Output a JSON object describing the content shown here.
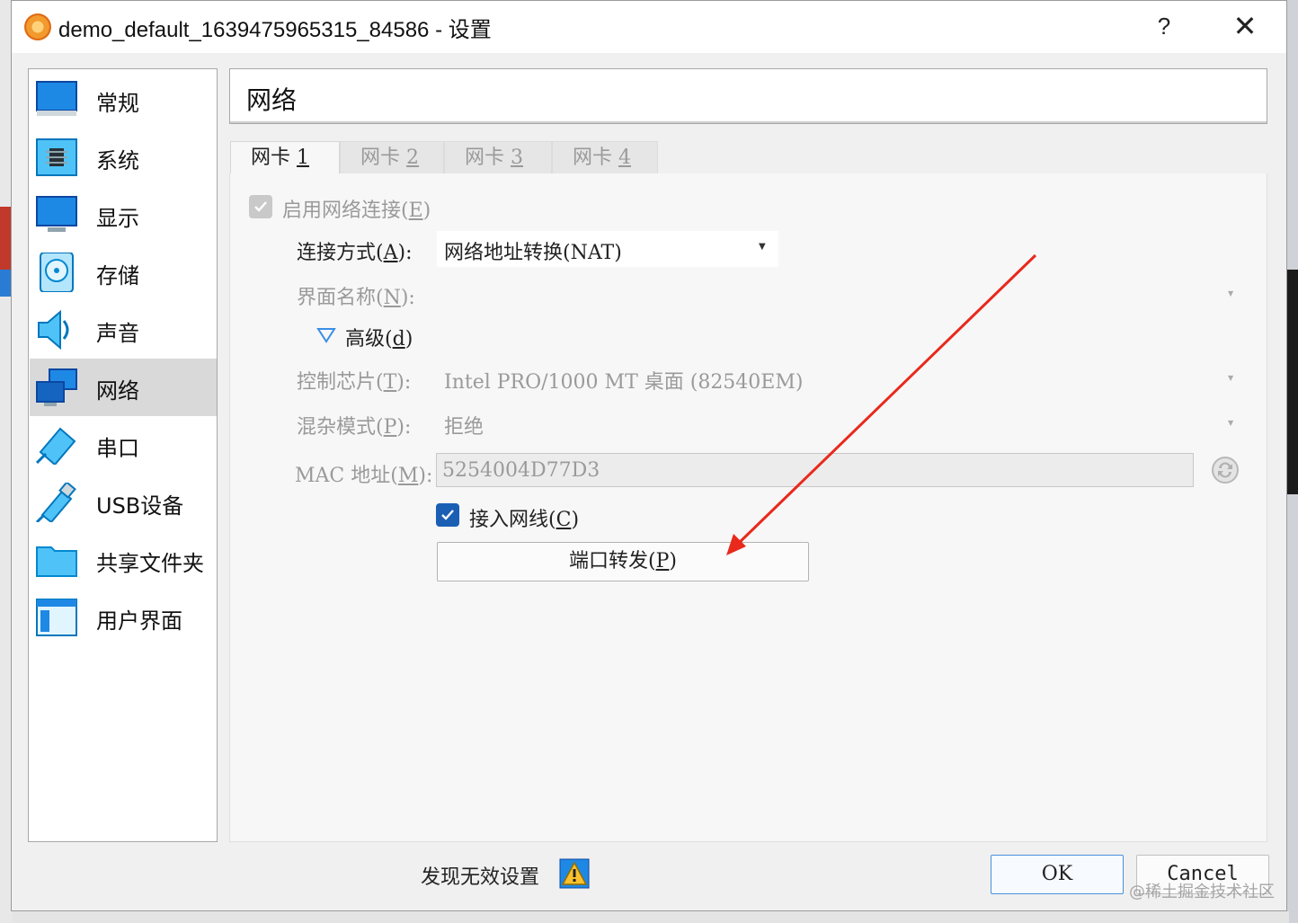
{
  "window": {
    "title": "demo_default_1639475965315_84586 - 设置",
    "help": "?",
    "close": "✕"
  },
  "sidebar": {
    "items": [
      {
        "label": "常规",
        "icon": "monitor-icon"
      },
      {
        "label": "系统",
        "icon": "chip-icon"
      },
      {
        "label": "显示",
        "icon": "display-icon"
      },
      {
        "label": "存储",
        "icon": "disk-icon"
      },
      {
        "label": "声音",
        "icon": "speaker-icon"
      },
      {
        "label": "网络",
        "icon": "network-icon"
      },
      {
        "label": "串口",
        "icon": "serial-port-icon"
      },
      {
        "label": "USB设备",
        "icon": "usb-icon"
      },
      {
        "label": "共享文件夹",
        "icon": "folder-icon"
      },
      {
        "label": "用户界面",
        "icon": "window-icon"
      }
    ],
    "selected": "网络"
  },
  "page": {
    "title": "网络"
  },
  "tabs": [
    {
      "label": "网卡 ",
      "key": "1"
    },
    {
      "label": "网卡 ",
      "key": "2"
    },
    {
      "label": "网卡 ",
      "key": "3"
    },
    {
      "label": "网卡 ",
      "key": "4"
    }
  ],
  "form": {
    "enable": {
      "label": "启用网络连接(",
      "key": "E",
      "close": ")",
      "checked": true,
      "disabled": true
    },
    "attached": {
      "label": "连接方式(",
      "key": "A",
      "close": "):",
      "value": "网络地址转换(NAT)"
    },
    "name": {
      "label": "界面名称(",
      "key": "N",
      "close": "):",
      "value": ""
    },
    "advanced": {
      "label": "高级(",
      "key": "d",
      "close": ")"
    },
    "adapter": {
      "label": "控制芯片(",
      "key": "T",
      "close": "):",
      "value": "Intel PRO/1000 MT 桌面 (82540EM)"
    },
    "promisc": {
      "label": "混杂模式(",
      "key": "P",
      "close": "):",
      "value": "拒绝"
    },
    "mac": {
      "label": "MAC 地址(",
      "key": "M",
      "close": "):",
      "value": "5254004D77D3"
    },
    "cable": {
      "label": "接入网线(",
      "key": "C",
      "close": ")",
      "checked": true
    },
    "port_forward": {
      "label": "端口转发(",
      "key": "P",
      "close": ")"
    }
  },
  "footer": {
    "warning": "发现无效设置",
    "ok": "OK",
    "cancel": "Cancel"
  },
  "watermark": "@稀土掘金技术社区",
  "colors": {
    "accent": "#1a5fb4",
    "arrow": "#e8291c",
    "selected_bg": "#d9d9d9"
  }
}
